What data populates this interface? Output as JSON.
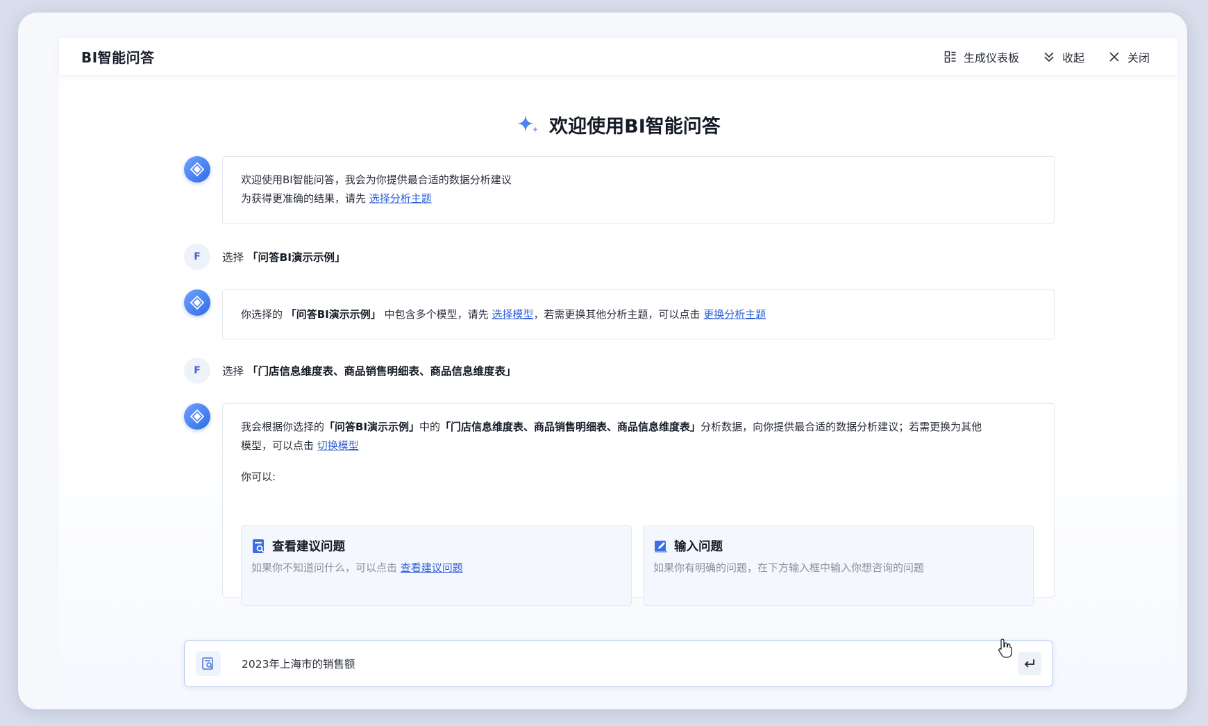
{
  "header": {
    "title": "BI智能问答",
    "actions": [
      {
        "label": "生成仪表板",
        "icon": "dashboard-icon"
      },
      {
        "label": "收起",
        "icon": "collapse-icon"
      },
      {
        "label": "关闭",
        "icon": "close-icon"
      }
    ]
  },
  "welcome": {
    "title": "欢迎使用BI智能问答",
    "icon": "sparkle-icon"
  },
  "messages": {
    "m1": {
      "line1": "欢迎使用BI智能问答，我会为你提供最合适的数据分析建议",
      "line2_prefix": "为获得更准确的结果，请先",
      "line2_link": "选择分析主题"
    },
    "u1": {
      "avatar": "F",
      "prefix": "选择",
      "value": "「问答BI演示示例」"
    },
    "m2": {
      "p1": "你选择的",
      "b1": "「问答BI演示示例」",
      "p2": "中包含多个模型，请先",
      "link1": "选择模型",
      "p3": "，若需更换其他分析主题，可以点击",
      "link2": "更换分析主题"
    },
    "u2": {
      "avatar": "F",
      "prefix": "选择",
      "value": "「门店信息维度表、商品销售明细表、商品信息维度表」"
    },
    "m3": {
      "p1": "我会根据你选择的",
      "b1": "「问答BI演示示例」",
      "p2": "中的",
      "b2": "「门店信息维度表、商品销售明细表、商品信息维度表」",
      "p3": "分析数据，向你提供最合适的数据分析建议；若需更换为其他",
      "p4": "模型，可以点击",
      "link1": "切换模型",
      "you_can": "你可以:",
      "cards": [
        {
          "title": "查看建议问题",
          "desc": "如果你不知道问什么，可以点击",
          "link": "查看建议问题",
          "icon": "suggestion-icon"
        },
        {
          "title": "输入问题",
          "desc": "如果你有明确的问题，在下方输入框中输入你想咨询的问题",
          "icon": "edit-icon"
        }
      ]
    }
  },
  "input": {
    "value": "2023年上海市的销售额",
    "icon": "search-doc-icon",
    "send_icon": "enter-icon"
  },
  "colors": {
    "accent": "#2f5fd6",
    "bot_avatar": "#3f78ee",
    "card_bg": "#f4f7fd"
  }
}
